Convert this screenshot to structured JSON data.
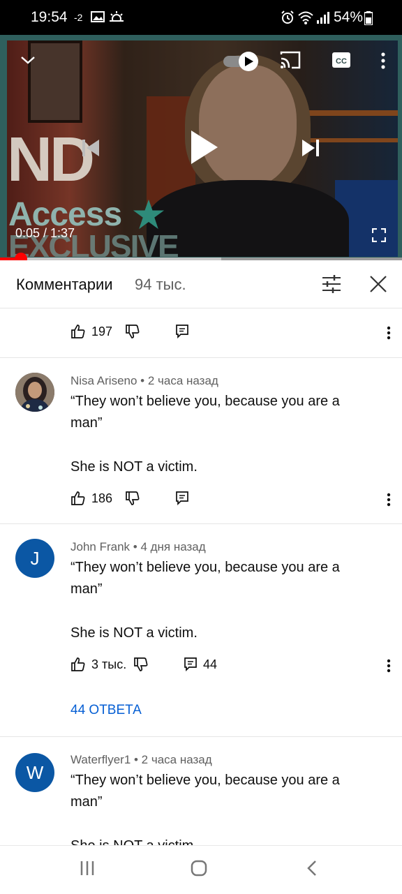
{
  "status_bar": {
    "time": "19:54",
    "notification_count": "-2",
    "battery": "54%"
  },
  "player": {
    "time_current": "0:05",
    "time_total": "1:37",
    "time_display": "0:05 / 1:37",
    "progress_fraction": 0.052,
    "buffer_fraction": 0.55,
    "overlay_text": {
      "brand_top": "ND",
      "brand": "Access",
      "brand_sub": "EXCLUSIVE"
    },
    "icons": [
      "chevron-down-icon",
      "autoplay-toggle-icon",
      "cast-icon",
      "closed-captions-icon",
      "more-vertical-icon",
      "previous-icon",
      "play-icon",
      "next-icon",
      "fullscreen-icon"
    ]
  },
  "comments_header": {
    "title": "Комментарии",
    "count": "94 тыс."
  },
  "comments": [
    {
      "likes": "197",
      "replies_count": ""
    },
    {
      "author": "Nisa Ariseno",
      "time": "2 часа назад",
      "meta": "Nisa Ariseno • 2 часа назад",
      "text_line1": "“They won’t believe you, because you are a",
      "text_line2": "man”",
      "text_line3": "She is NOT a victim.",
      "likes": "186",
      "replies_count": ""
    },
    {
      "author": "John Frank",
      "time": "4 дня назад",
      "meta": "John Frank • 4 дня назад",
      "avatar_letter": "J",
      "avatar_color": "#0b57a4",
      "text_line1": "“They won’t believe you, because you are a",
      "text_line2": "man”",
      "text_line3": "She is NOT a victim.",
      "likes": "3 тыс.",
      "replies_count": "44",
      "replies_link": "44 ОТВЕТА"
    },
    {
      "author": "Waterflyer1",
      "time": "2 часа назад",
      "meta": "Waterflyer1 • 2 часа назад",
      "avatar_letter": "W",
      "avatar_color": "#0b57a4",
      "text_line1": "“They won’t believe you, because you are a",
      "text_line2": "man”",
      "text_line3": "She is NOT a victim."
    }
  ],
  "colors": {
    "accent_red": "#ff0000",
    "link_blue": "#065fd4",
    "player_frame": "#2f5f5d"
  }
}
